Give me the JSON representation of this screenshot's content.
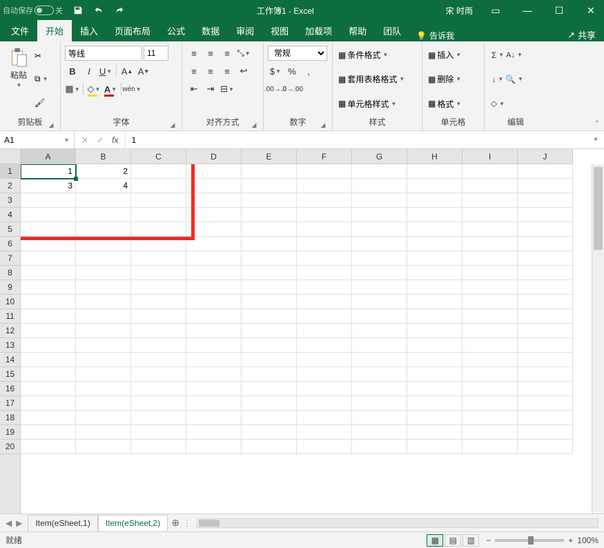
{
  "titlebar": {
    "autosave_label": "自动保存",
    "toggle_state": "关",
    "title": "工作簿1 - Excel",
    "user": "宋 时雨"
  },
  "tabs": {
    "file": "文件",
    "home": "开始",
    "insert": "插入",
    "layout": "页面布局",
    "formulas": "公式",
    "data": "数据",
    "review": "审阅",
    "view": "视图",
    "addins": "加载项",
    "help": "帮助",
    "team": "团队",
    "tellme": "告诉我",
    "share": "共享"
  },
  "ribbon": {
    "clipboard": {
      "paste": "粘贴",
      "label": "剪贴板"
    },
    "font": {
      "name": "等线",
      "size": "11",
      "label": "字体",
      "wen": "wén"
    },
    "align": {
      "label": "对齐方式"
    },
    "number": {
      "format": "常规",
      "label": "数字"
    },
    "styles": {
      "cond": "条件格式",
      "table": "套用表格格式",
      "cell": "单元格样式",
      "label": "样式"
    },
    "cells": {
      "insert": "插入",
      "delete": "删除",
      "format": "格式",
      "label": "单元格"
    },
    "editing": {
      "label": "编辑"
    }
  },
  "namebox": "A1",
  "formula_value": "1",
  "columns": [
    "A",
    "B",
    "C",
    "D",
    "E",
    "F",
    "G",
    "H",
    "I",
    "J"
  ],
  "row_count": 20,
  "cells": {
    "A1": "1",
    "B1": "2",
    "A2": "3",
    "B2": "4"
  },
  "sheet_tabs": {
    "t1": "Item(eSheet,1)",
    "t2": "Item(eSheet,2)"
  },
  "status": {
    "ready": "就绪",
    "zoom": "100%"
  }
}
